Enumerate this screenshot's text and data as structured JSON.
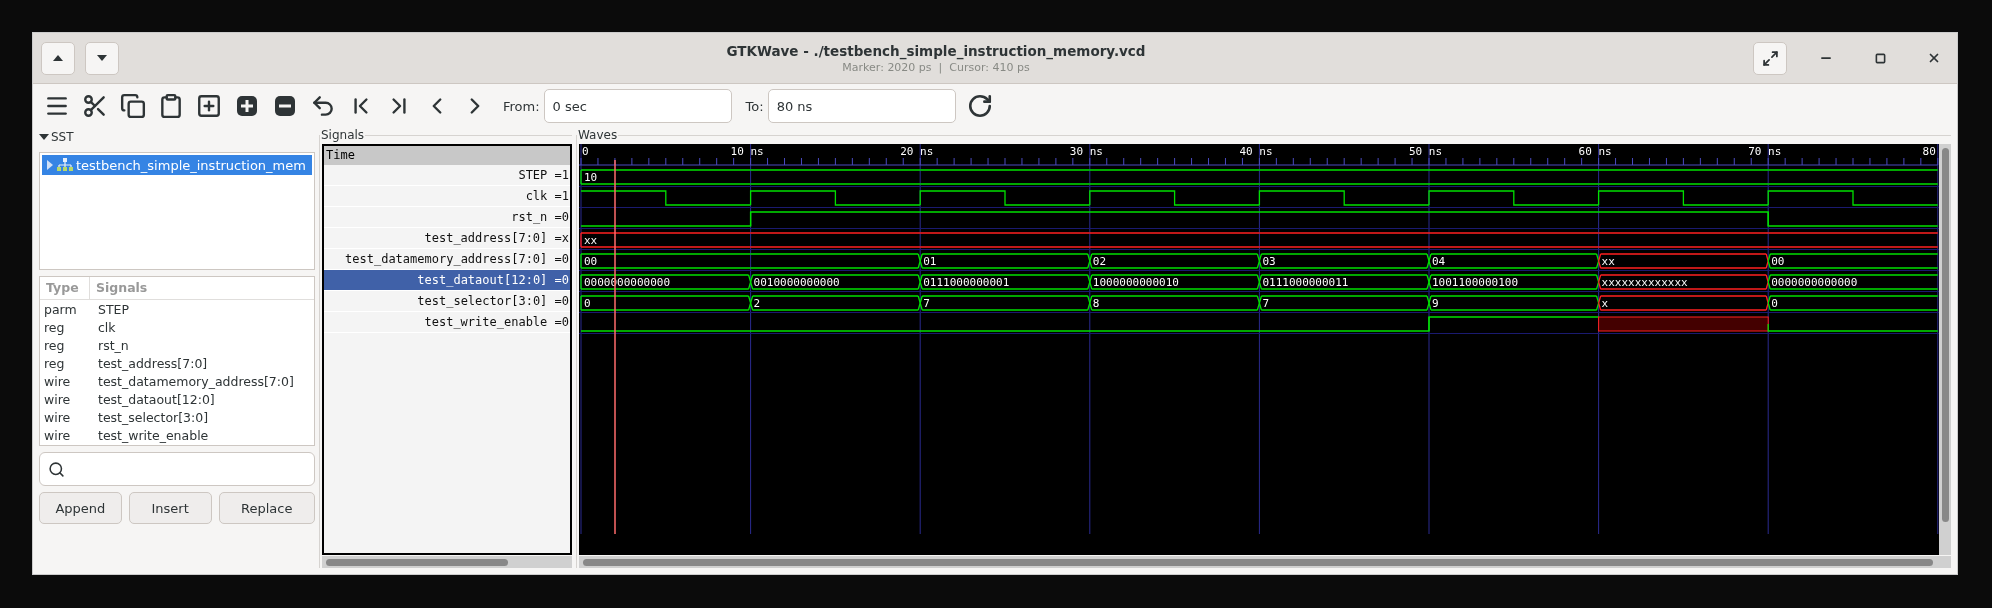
{
  "window": {
    "title": "GTKWave - ./testbench_simple_instruction_memory.vcd",
    "subtitle": "Marker: 2020 ps  |  Cursor: 410 ps"
  },
  "toolbar": {
    "from_label": "From:",
    "from_value": "0 sec",
    "to_label": "To:",
    "to_value": "80 ns"
  },
  "sst": {
    "title": "SST",
    "expanded": true,
    "items": [
      {
        "label": "testbench_simple_instruction_mem",
        "selected": true,
        "expanded": false
      }
    ]
  },
  "signal_list": {
    "columns": [
      "Type",
      "Signals"
    ],
    "rows": [
      {
        "type": "parm",
        "name": "STEP"
      },
      {
        "type": "reg",
        "name": "clk"
      },
      {
        "type": "reg",
        "name": "rst_n"
      },
      {
        "type": "reg",
        "name": "test_address[7:0]"
      },
      {
        "type": "wire",
        "name": "test_datamemory_address[7:0]"
      },
      {
        "type": "wire",
        "name": "test_dataout[12:0]"
      },
      {
        "type": "wire",
        "name": "test_selector[3:0]"
      },
      {
        "type": "wire",
        "name": "test_write_enable"
      }
    ]
  },
  "buttons": [
    "Append",
    "Insert",
    "Replace"
  ],
  "signals_pane": {
    "title": "Signals",
    "header": "Time",
    "rows": [
      {
        "label": "STEP =1",
        "selected": false
      },
      {
        "label": "clk =1",
        "selected": false
      },
      {
        "label": "rst_n =0",
        "selected": false
      },
      {
        "label": "test_address[7:0] =x",
        "selected": false
      },
      {
        "label": "test_datamemory_address[7:0] =0",
        "selected": false
      },
      {
        "label": "test_dataout[12:0] =0",
        "selected": true
      },
      {
        "label": "test_selector[3:0] =0",
        "selected": false
      },
      {
        "label": "test_write_enable =0",
        "selected": false
      }
    ]
  },
  "waves": {
    "title": "Waves",
    "time_labels": [
      "0",
      "10 ns",
      "20 ns",
      "30 ns",
      "40 ns",
      "50 ns",
      "60 ns",
      "70 ns",
      "80"
    ],
    "traces": [
      {
        "kind": "bus",
        "cells": [
          {
            "value": "10",
            "continued": false,
            "unknown": false
          },
          {
            "continued": true,
            "unknown": false
          },
          {
            "continued": true,
            "unknown": false
          },
          {
            "continued": true,
            "unknown": false
          },
          {
            "continued": true,
            "unknown": false
          },
          {
            "continued": true,
            "unknown": false
          },
          {
            "continued": true,
            "unknown": false
          },
          {
            "continued": true,
            "unknown": false
          }
        ]
      },
      {
        "kind": "clock",
        "cells": [
          {
            "unknown": false
          },
          {
            "unknown": false
          },
          {
            "unknown": false
          },
          {
            "unknown": false
          },
          {
            "unknown": false
          },
          {
            "unknown": false
          },
          {
            "unknown": false
          },
          {
            "unknown": false
          }
        ]
      },
      {
        "kind": "bit",
        "cells": [
          {
            "high": false
          },
          {
            "high": true
          },
          {
            "high": true
          },
          {
            "high": true
          },
          {
            "high": true
          },
          {
            "high": true
          },
          {
            "high": true
          },
          {
            "high": false
          }
        ]
      },
      {
        "kind": "bus",
        "cells": [
          {
            "value": "xx",
            "continued": false,
            "unknown": true
          },
          {
            "continued": true,
            "unknown": true
          },
          {
            "continued": true,
            "unknown": true
          },
          {
            "continued": true,
            "unknown": true
          },
          {
            "continued": true,
            "unknown": true
          },
          {
            "continued": true,
            "unknown": true
          },
          {
            "continued": true,
            "unknown": true
          },
          {
            "continued": true,
            "unknown": true
          }
        ]
      },
      {
        "kind": "bus",
        "cells": [
          {
            "value": "00",
            "continued": false,
            "unknown": false
          },
          {
            "continued": true,
            "unknown": false
          },
          {
            "value": "01",
            "continued": false,
            "unknown": false
          },
          {
            "value": "02",
            "continued": false,
            "unknown": false
          },
          {
            "value": "03",
            "continued": false,
            "unknown": false
          },
          {
            "value": "04",
            "continued": false,
            "unknown": false
          },
          {
            "value": "xx",
            "continued": false,
            "unknown": true
          },
          {
            "value": "00",
            "continued": false,
            "unknown": false
          }
        ]
      },
      {
        "kind": "bus",
        "cells": [
          {
            "value": "0000000000000",
            "continued": false,
            "unknown": false
          },
          {
            "value": "0010000000000",
            "continued": false,
            "unknown": false
          },
          {
            "value": "0111000000001",
            "continued": false,
            "unknown": false
          },
          {
            "value": "1000000000010",
            "continued": false,
            "unknown": false
          },
          {
            "value": "0111000000011",
            "continued": false,
            "unknown": false
          },
          {
            "value": "1001100000100",
            "continued": false,
            "unknown": false
          },
          {
            "value": "xxxxxxxxxxxxx",
            "continued": false,
            "unknown": true
          },
          {
            "value": "0000000000000",
            "continued": false,
            "unknown": false
          }
        ]
      },
      {
        "kind": "bus",
        "cells": [
          {
            "value": "0",
            "continued": false,
            "unknown": false
          },
          {
            "value": "2",
            "continued": false,
            "unknown": false
          },
          {
            "value": "7",
            "continued": false,
            "unknown": false
          },
          {
            "value": "8",
            "continued": false,
            "unknown": false
          },
          {
            "value": "7",
            "continued": false,
            "unknown": false
          },
          {
            "value": "9",
            "continued": false,
            "unknown": false
          },
          {
            "value": "x",
            "continued": false,
            "unknown": true
          },
          {
            "value": "0",
            "continued": false,
            "unknown": false
          }
        ]
      },
      {
        "kind": "bit",
        "cells": [
          {
            "high": false
          },
          {
            "high": false
          },
          {
            "high": false
          },
          {
            "high": false
          },
          {
            "high": false
          },
          {
            "high": true
          },
          {
            "unknown": true
          },
          {
            "high": false
          }
        ]
      }
    ]
  }
}
